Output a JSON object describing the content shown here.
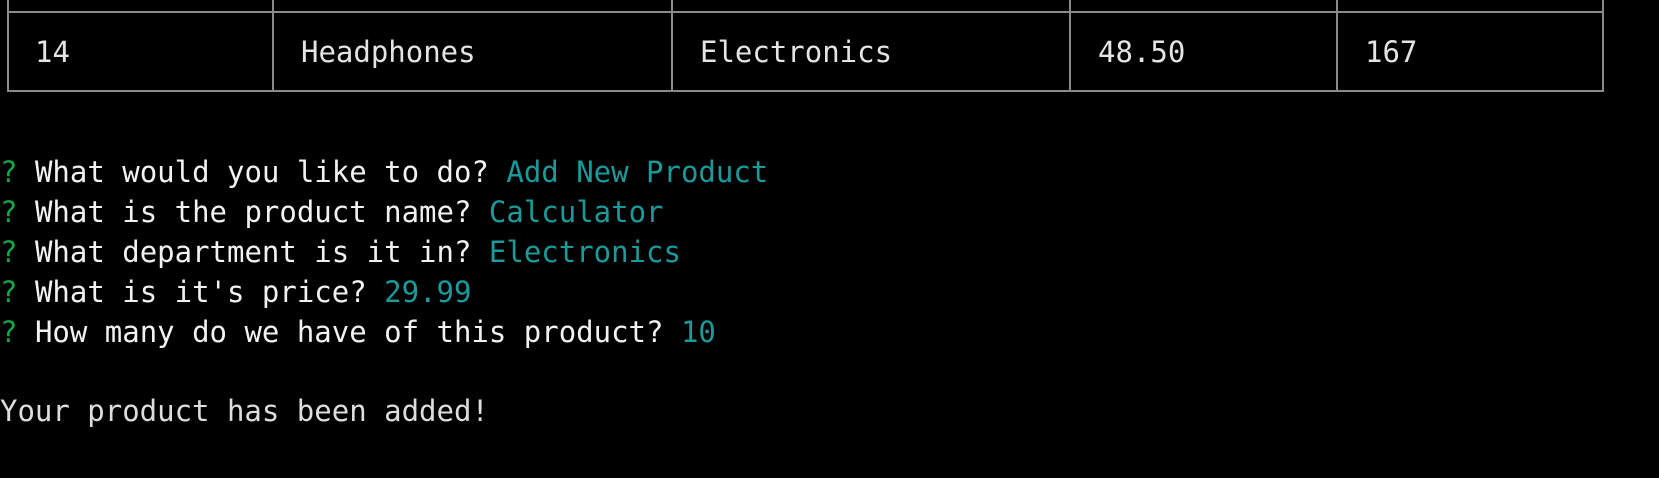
{
  "table": {
    "row": [
      "14",
      "Headphones",
      "Electronics",
      "48.50",
      "167"
    ]
  },
  "prompt_marker": "?",
  "prompts": [
    {
      "question": "What would you like to do?",
      "answer": "Add New Product"
    },
    {
      "question": "What is the product name?",
      "answer": "Calculator"
    },
    {
      "question": "What department is it in?",
      "answer": "Electronics"
    },
    {
      "question": "What is it's price?",
      "answer": "29.99"
    },
    {
      "question": "How many do we have of this product?",
      "answer": "10"
    }
  ],
  "result_message": "Your product has been added!",
  "colors": {
    "background": "#000000",
    "prompt_marker": "#16a34a",
    "answer": "#1a9a9a",
    "table_border": "#8a8a8a"
  }
}
